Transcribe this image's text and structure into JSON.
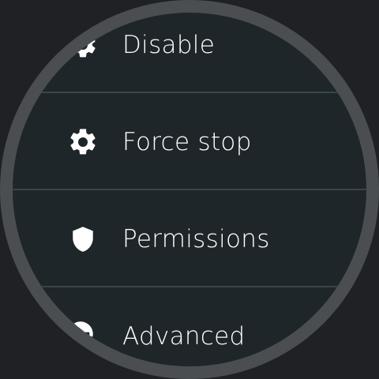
{
  "menu": {
    "items": [
      {
        "label": "Disable",
        "icon": "gear-icon"
      },
      {
        "label": "Force stop",
        "icon": "gear-icon"
      },
      {
        "label": "Permissions",
        "icon": "shield-icon"
      },
      {
        "label": "Advanced",
        "icon": "advanced-settings-icon"
      }
    ]
  },
  "colors": {
    "background": "#202124",
    "ring": "#4b4e51",
    "face": "#1e262a",
    "divider": "#3a4448",
    "text": "#ffffff"
  }
}
